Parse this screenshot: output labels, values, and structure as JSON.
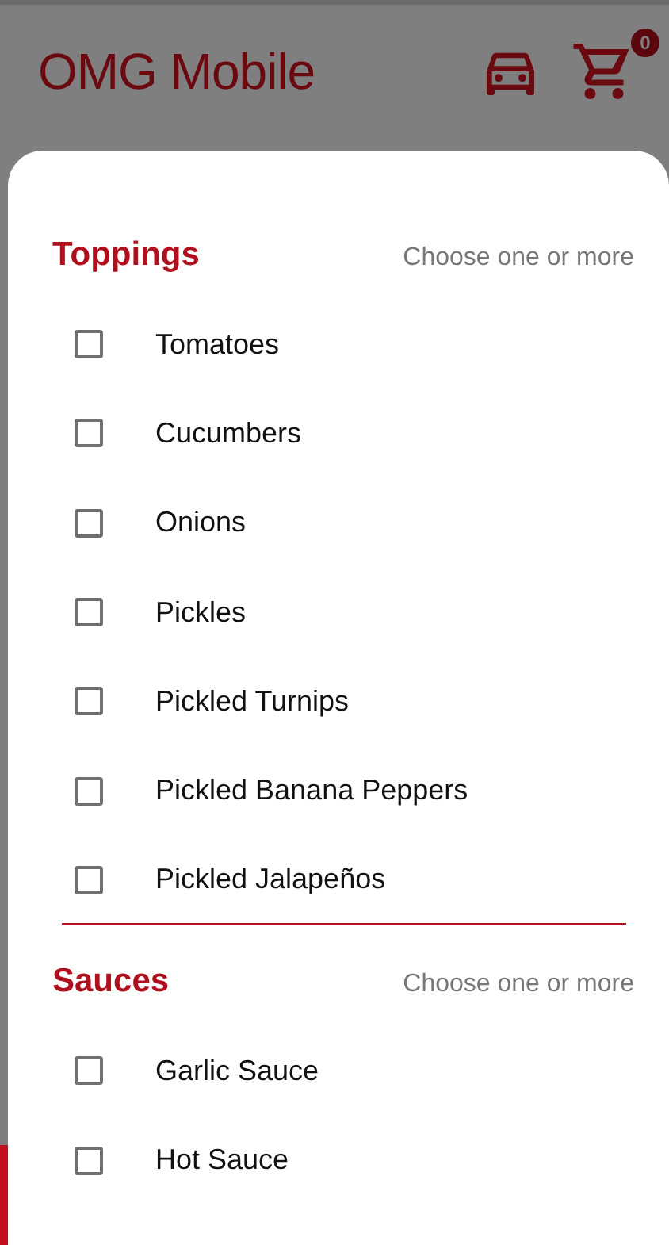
{
  "app_bar": {
    "title": "OMG Mobile",
    "cart_count": "0"
  },
  "sections": [
    {
      "title": "Toppings",
      "hint": "Choose one or more",
      "options": [
        {
          "label": "Tomatoes",
          "checked": false
        },
        {
          "label": "Cucumbers",
          "checked": false
        },
        {
          "label": "Onions",
          "checked": false
        },
        {
          "label": "Pickles",
          "checked": false
        },
        {
          "label": "Pickled Turnips",
          "checked": false
        },
        {
          "label": "Pickled Banana Peppers",
          "checked": false
        },
        {
          "label": "Pickled Jalapeños",
          "checked": false
        }
      ]
    },
    {
      "title": "Sauces",
      "hint": "Choose one or more",
      "options": [
        {
          "label": "Garlic Sauce",
          "checked": false
        },
        {
          "label": "Hot Sauce",
          "checked": false
        }
      ]
    }
  ]
}
